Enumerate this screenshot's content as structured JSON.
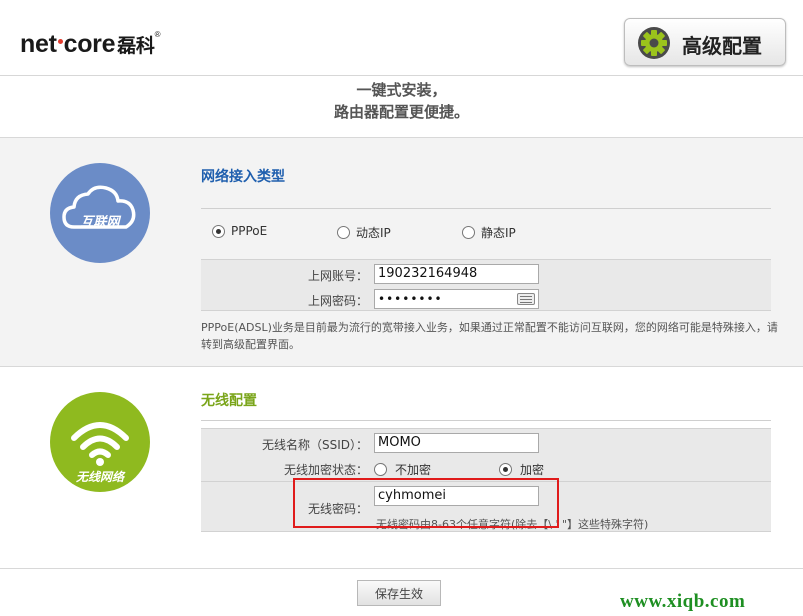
{
  "header": {
    "brand_text": "net",
    "brand_text2": "core",
    "brand_cn": "磊科",
    "brand_reg": "®",
    "advanced_label": "高级配置"
  },
  "slogan": {
    "line1": "一键式安装，",
    "line2": "路由器配置更便捷。"
  },
  "wan": {
    "icon_label": "互联网",
    "title": "网络接入类型",
    "options": [
      {
        "label": "PPPoE",
        "selected": true
      },
      {
        "label": "动态IP",
        "selected": false
      },
      {
        "label": "静态IP",
        "selected": false
      }
    ],
    "account_label": "上网账号：",
    "account_value": "190232164948",
    "password_label": "上网密码：",
    "password_value": "••••••••",
    "description": "PPPoE(ADSL)业务是目前最为流行的宽带接入业务，如果通过正常配置不能访问互联网，您的网络可能是特殊接入，请转到高级配置界面。"
  },
  "wifi": {
    "icon_label": "无线网络",
    "title": "无线配置",
    "ssid_label": "无线名称（SSID）：",
    "ssid_value": "MOMO",
    "encrypt_label": "无线加密状态：",
    "encrypt_options": [
      {
        "label": "不加密",
        "selected": false
      },
      {
        "label": "加密",
        "selected": true
      }
    ],
    "password_label": "无线密码：",
    "password_value": "cyhmomei",
    "password_hint": "无线密码由8-63个任意字符(除去【\\ ' \"】这些特殊字符)"
  },
  "footer": {
    "save_label": "保存生效"
  },
  "watermark": "www.xiqb.com",
  "colors": {
    "wan_title": "#1f5fae",
    "wifi_title": "#7aa51a",
    "net_circle": "#6b8cc7",
    "wifi_circle": "#8fba1f",
    "highlight_box": "#e01b1b"
  }
}
